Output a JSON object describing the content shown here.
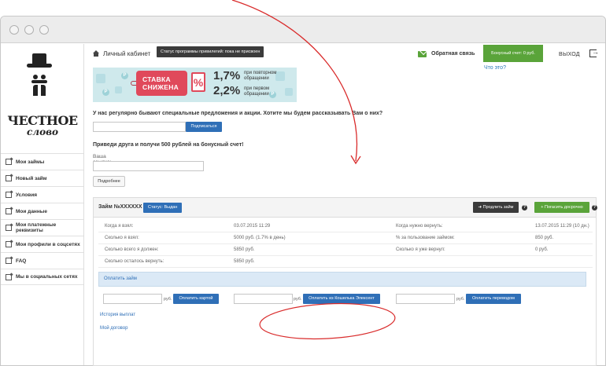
{
  "header": {
    "page_title": "Личный кабинет",
    "status_badge": "Статус программы привилегий: пока не присвоен",
    "feedback_label": "Обратная связь",
    "bonus_label": "Бонусный счет: 0 руб.",
    "what_label": "Что это?",
    "logout_label": "ВЫХОД"
  },
  "logo": {
    "line1": "ЧЕСТНОЕ",
    "line2": "слово"
  },
  "sidebar": {
    "items": [
      {
        "label": "Мои займы"
      },
      {
        "label": "Новый займ"
      },
      {
        "label": "Условия"
      },
      {
        "label": "Мои данные"
      },
      {
        "label": "Мои платежные реквизиты"
      },
      {
        "label": "Мои профили в соцсетях"
      },
      {
        "label": "FAQ"
      },
      {
        "label": "Мы в социальных сетях"
      }
    ]
  },
  "banner": {
    "tag_line1": "СТАВКА",
    "tag_line2": "СНИЖЕНА",
    "pct_symbol": "%",
    "rate1": "1,7%",
    "desc1a": "при повторном",
    "desc1b": "обращении",
    "rate2": "2,2%",
    "desc2a": "при первом",
    "desc2b": "обращении"
  },
  "subscribe": {
    "question": "У нас регулярно бывают специальные предложения и акции. Хотите мы будем рассказывать Вам о них?",
    "button": "Подписаться"
  },
  "invite": {
    "title": "Приведи друга и получи 500 рублей на бонусный счет!",
    "link_label": "Ваша ссылка:",
    "button": "Подробнее"
  },
  "loan": {
    "title": "Займ №XXXXXX",
    "status": "Статус: Выдан",
    "extend_button": "Продлить займ",
    "repay_button": "Погасить досрочно",
    "rows": [
      {
        "l1": "Когда я взял:",
        "v1": "03.07.2015 11:29",
        "l2": "Когда нужно вернуть:",
        "v2": "13.07.2015 11:29 (10 дн.)"
      },
      {
        "l1": "Сколько я взял:",
        "v1": "5000 руб. (1.7% в день)",
        "l2": "% за пользование займом:",
        "v2": "850 руб."
      },
      {
        "l1": "Сколько всего я должен:",
        "v1": "5850 руб.",
        "l2": "Сколько я уже вернул:",
        "v2": "0 руб."
      },
      {
        "l1": "Сколько осталось вернуть:",
        "v1": "5850 руб."
      }
    ],
    "pay_header": "Оплатить займ",
    "currency": "руб.",
    "pay_card": "Оплатить картой",
    "pay_wallet": "Оплатить из Кошелька Элексент",
    "pay_transfer": "Оплатить переводом",
    "history_link": "История выплат",
    "contract_link": "Мой договор"
  },
  "colors": {
    "accent_blue": "#2f6fb7",
    "accent_green": "#5aa43a",
    "banner_red": "#e0495b",
    "annotation_red": "#d92b2b"
  }
}
